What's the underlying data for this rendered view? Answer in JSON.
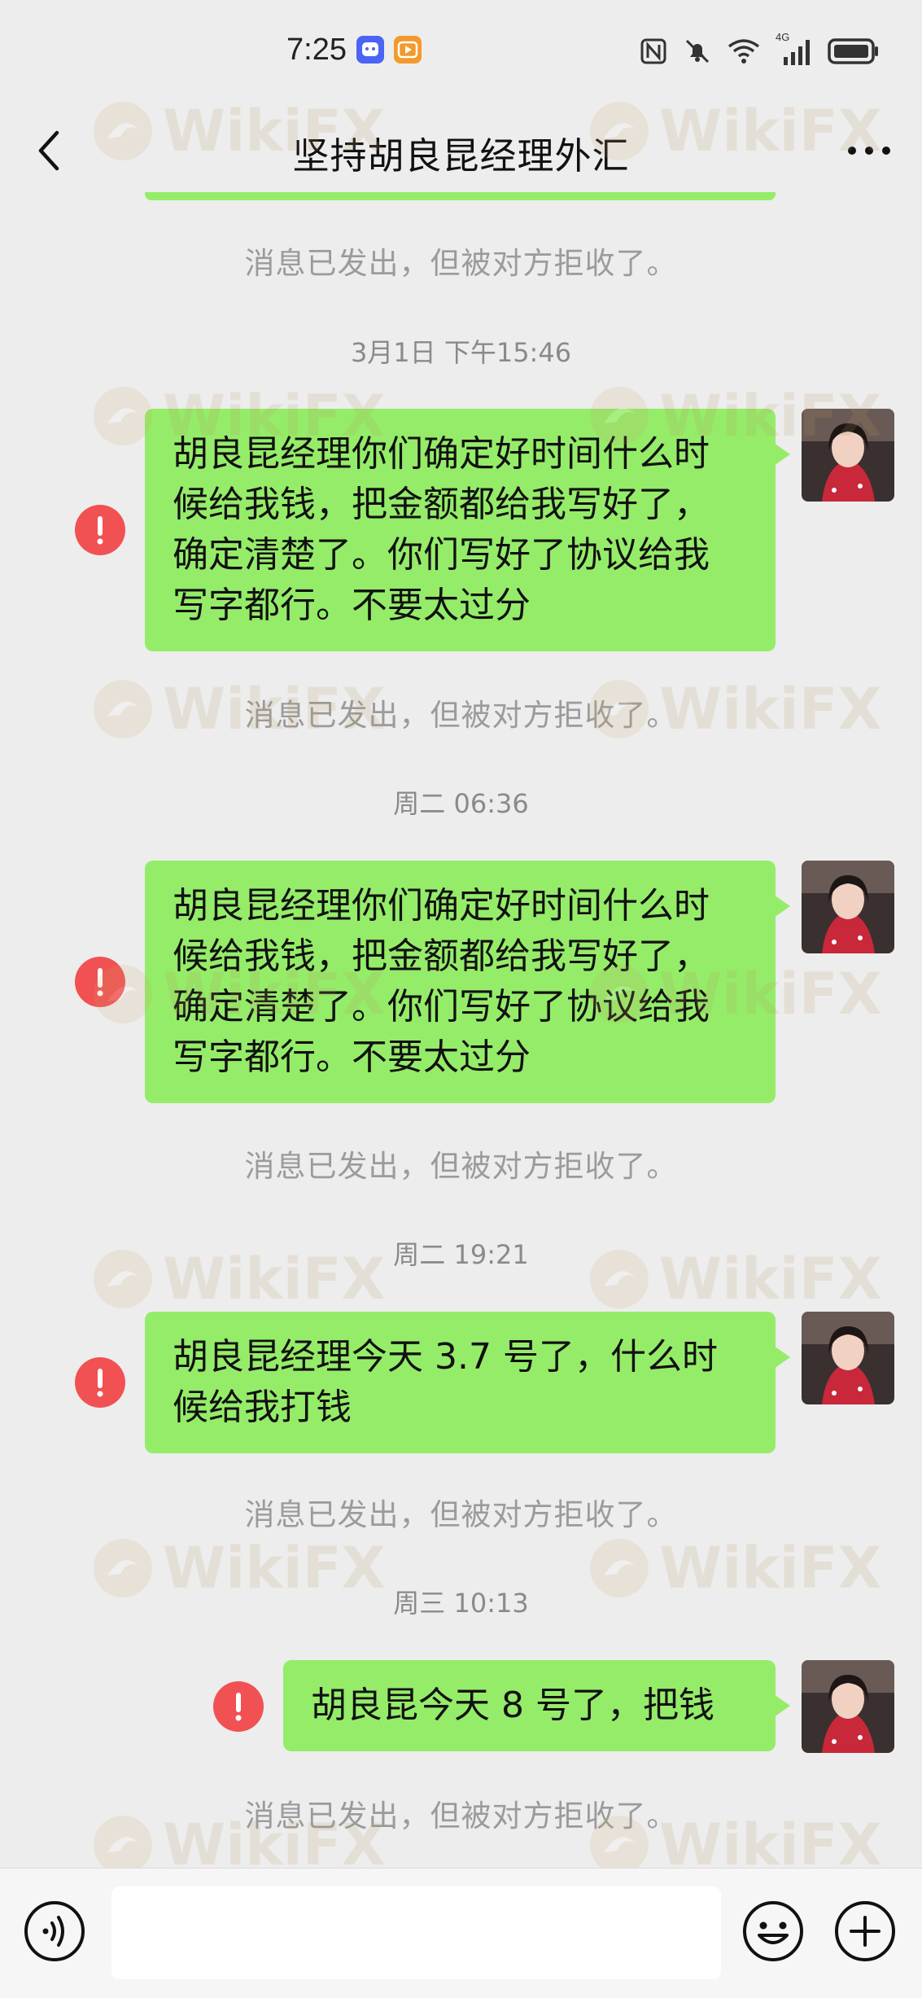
{
  "status_bar": {
    "time": "7:25",
    "network": "4G"
  },
  "header": {
    "title": "坚持胡良昆经理外汇"
  },
  "watermark": {
    "text": "WikiFX"
  },
  "messages": [
    {
      "sys_before": "消息已发出，但被对方拒收了。"
    },
    {
      "timestamp": "3月1日 下午15:46",
      "lines": [
        "胡良昆经理你们确定好时间什么时",
        "候给我钱，把金额都给我写好了，",
        "确定清楚了。你们写好了协议给我",
        "写字都行。不要太过分"
      ],
      "sys_after": "消息已发出，但被对方拒收了。"
    },
    {
      "timestamp": "周二 06:36",
      "lines": [
        "胡良昆经理你们确定好时间什么时",
        "候给我钱，把金额都给我写好了，",
        "确定清楚了。你们写好了协议给我",
        "写字都行。不要太过分"
      ],
      "sys_after": "消息已发出，但被对方拒收了。"
    },
    {
      "timestamp": "周二 19:21",
      "lines": [
        "胡良昆经理今天 3.7 号了，什么时",
        "候给我打钱"
      ],
      "sys_after": "消息已发出，但被对方拒收了。"
    },
    {
      "timestamp": "周三 10:13",
      "lines": [
        "胡良昆今天 8 号了，把钱"
      ],
      "sys_after": "消息已发出，但被对方拒收了。"
    }
  ],
  "colors": {
    "background": "#ededed",
    "bubble": "#95ec69",
    "error": "#f15152",
    "system_text": "#9b9b9b"
  },
  "icons": {
    "back": "chevron-left-icon",
    "more": "more-dots-icon",
    "error": "exclamation-icon",
    "voice": "voice-icon",
    "emoji": "emoji-icon",
    "plus": "plus-icon"
  }
}
